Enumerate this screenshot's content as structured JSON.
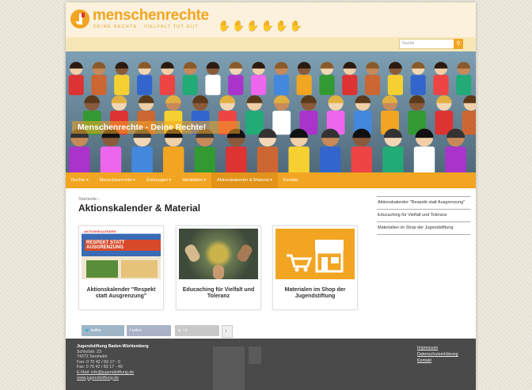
{
  "site": {
    "brand": "menschenrechte",
    "tagline": "DEINE RECHTE · VIELFALT TUT GUT",
    "search_placeholder": "Suche"
  },
  "hero": {
    "title": "Menschenrechte - Deine Rechte!"
  },
  "nav": [
    {
      "label": "Rechte ▾"
    },
    {
      "label": "Menschenrechte ▾"
    },
    {
      "label": "Zeitzeugen ▾"
    },
    {
      "label": "Identitäten ▾"
    },
    {
      "label": "Aktionskalender & Material ▾"
    },
    {
      "label": "Kontakt"
    }
  ],
  "breadcrumb": "Startseite ›",
  "page_title": "Aktionskalender & Material",
  "cards": [
    {
      "label": "Aktionskalender \"Respekt statt Ausgrenzung\"",
      "img_text": "RESPEKT STATT AUSGRENZUNG",
      "img_small": "AKTIONSKALENDER"
    },
    {
      "label": "Educaching für Vielfalt und Toleranz"
    },
    {
      "label": "Materialen im Shop der Jugendstiftung"
    }
  ],
  "sidebar": [
    "Aktionskalender \"Respekt statt Ausgrenzung\"",
    "Educaching für Vielfalt und Toleranz",
    "Materialien im Shop der Jugendstiftung"
  ],
  "share": {
    "twitter": "twitter",
    "facebook": "teilen",
    "gplus": "+1",
    "info": "i"
  },
  "footer": {
    "org": "Jugendstiftung Baden-Württemberg",
    "lines": [
      "Schloßstr. 23",
      "74372 Sersheim",
      "Fon: 0 70 42 / 83 17 - 0",
      "Fax: 0 70 42 / 83 17 - 40",
      "E-Mail: info@jugendstiftung.de",
      "www.jugendstiftung.de"
    ],
    "links": [
      "Impressum",
      "Datenschutzerklärung",
      "Kontakt"
    ]
  },
  "colors": {
    "accent": "#f2a522",
    "footer": "#4a4a4a",
    "twitter": "#4b8fc8",
    "facebook": "#3b5998"
  }
}
